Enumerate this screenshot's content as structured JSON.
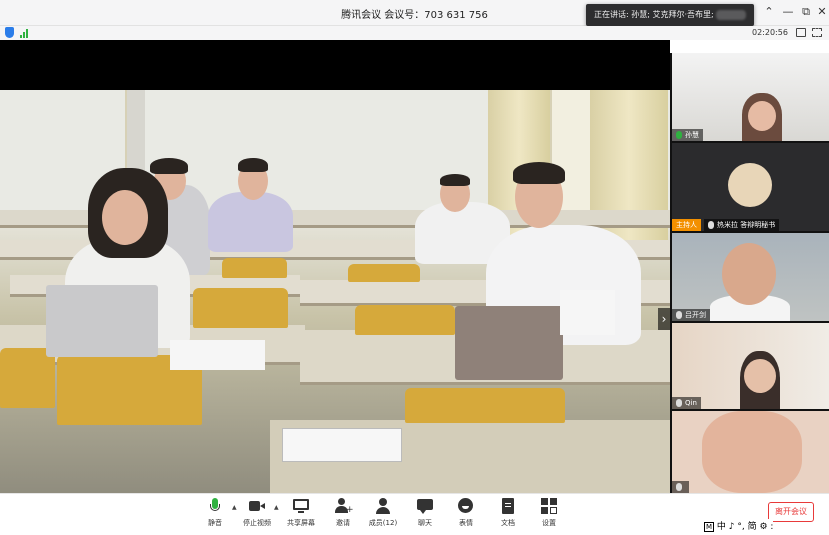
{
  "window": {
    "title": "腾讯会议 会议号：703 631 756",
    "pin_icon": "pin-icon",
    "minimize": "—",
    "restore": "⧉",
    "close": "✕"
  },
  "speaker_toast": {
    "prefix": "正在讲话: ",
    "names": "孙慧; 艾克拜尔·吾布里;"
  },
  "infobar": {
    "timer": "02:20:56"
  },
  "participants": [
    {
      "name": "孙慧",
      "mic": "on",
      "badge": ""
    },
    {
      "name": "热米拉 答辩明秘书",
      "mic": "off",
      "badge": "主持人"
    },
    {
      "name": "吕开剑",
      "mic": "off",
      "badge": ""
    },
    {
      "name": "Qin",
      "mic": "off",
      "badge": ""
    },
    {
      "name": "",
      "mic": "off",
      "badge": ""
    }
  ],
  "toolbar": {
    "mute": "静音",
    "stop_video": "停止视频",
    "share": "共享屏幕",
    "invite": "邀请",
    "members": "成员(12)",
    "chat": "聊天",
    "emoji": "表情",
    "docs": "文档",
    "settings": "设置",
    "leave": "离开会议"
  },
  "ime": {
    "mode": "M",
    "text": "中 ♪ °, 简 ⚙ :"
  },
  "colors": {
    "accent": "#2b7de9",
    "mic_active": "#2fb140",
    "host": "#f39000",
    "leave": "#e83a3a"
  }
}
